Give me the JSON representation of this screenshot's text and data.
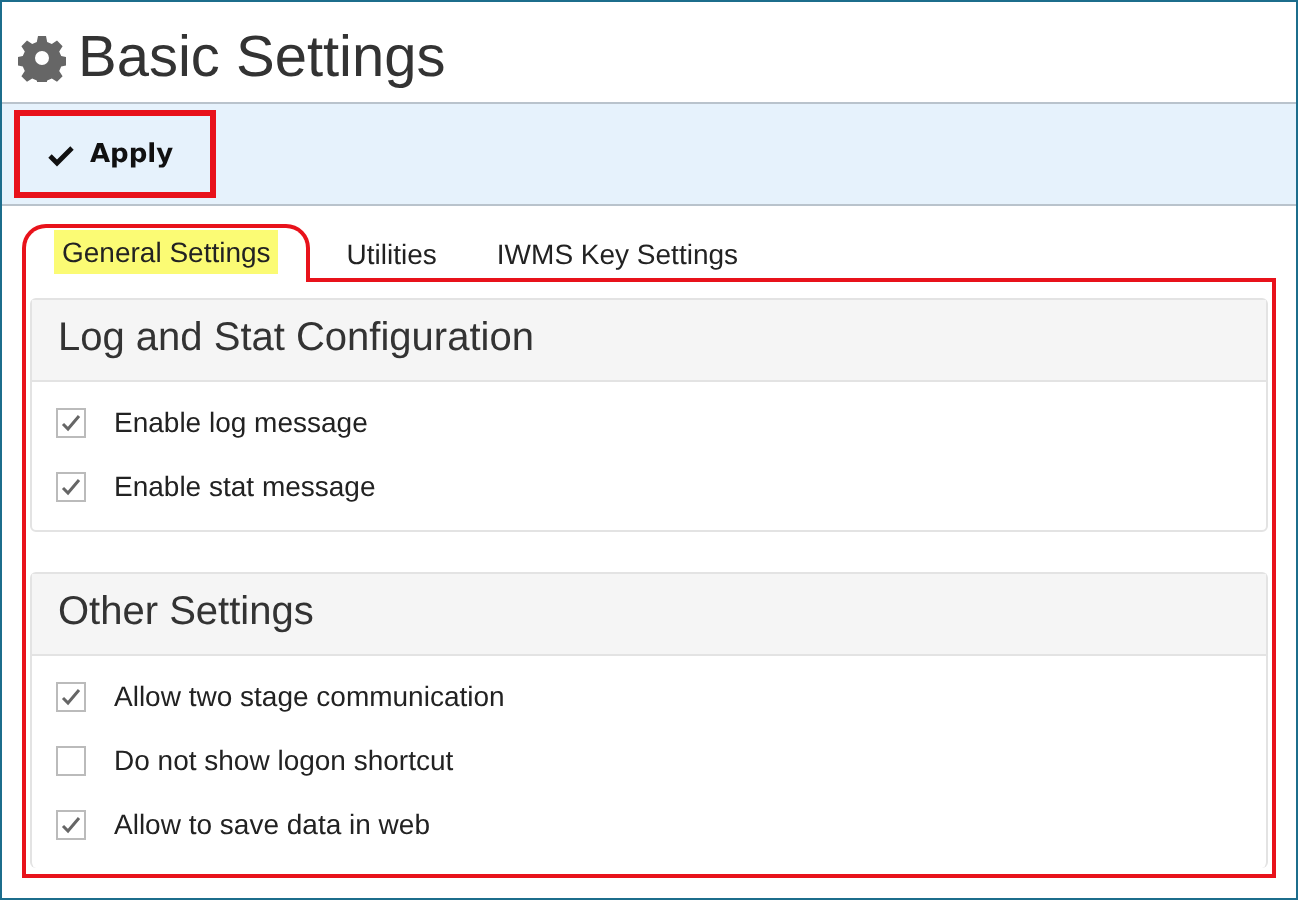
{
  "page": {
    "title": "Basic Settings"
  },
  "toolbar": {
    "buttons": [
      {
        "label": "Apply"
      }
    ]
  },
  "tabs": [
    {
      "label": "General Settings",
      "selected": true
    },
    {
      "label": "Utilities",
      "selected": false
    },
    {
      "label": "IWMS Key Settings",
      "selected": false
    }
  ],
  "sections": [
    {
      "title": "Log and Stat Configuration",
      "items": [
        {
          "label": "Enable log message",
          "checked": true
        },
        {
          "label": "Enable stat message",
          "checked": true
        }
      ]
    },
    {
      "title": "Other Settings",
      "items": [
        {
          "label": "Allow two stage communication",
          "checked": true
        },
        {
          "label": "Do not show logon shortcut",
          "checked": false
        },
        {
          "label": "Allow to save data in web",
          "checked": true
        }
      ]
    }
  ]
}
